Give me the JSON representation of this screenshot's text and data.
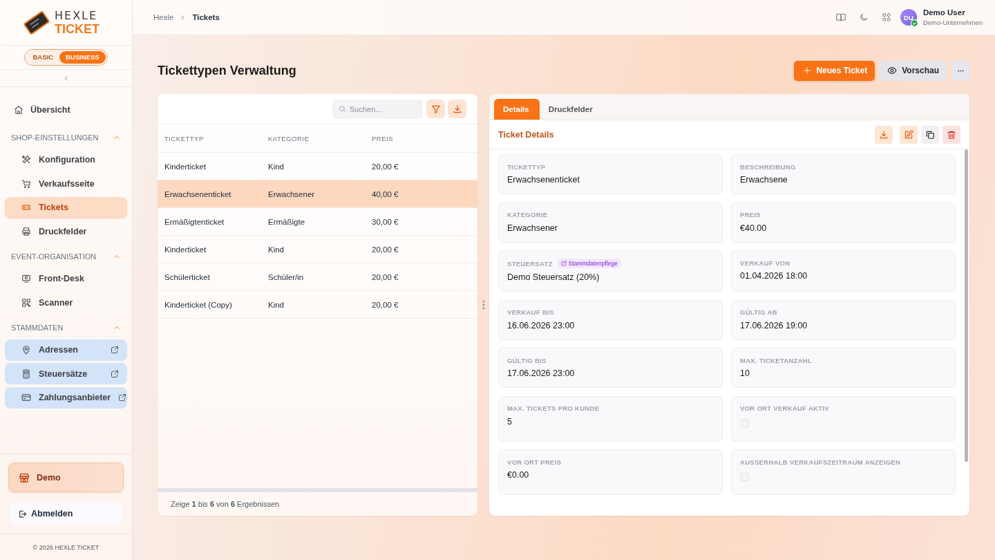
{
  "sidebar": {
    "logo": {
      "wordmark": "HEXLE",
      "product": "TICKET"
    },
    "plans": [
      {
        "label": "BASIC",
        "selected": false
      },
      {
        "label": "BUSINESS",
        "selected": true
      }
    ],
    "overview": {
      "label": "Übersicht",
      "selected": false
    },
    "sections": [
      {
        "title": "SHOP-EINSTELLUNGEN",
        "expanded": true,
        "items": [
          {
            "label": "Konfiguration",
            "selected": false,
            "external": false
          },
          {
            "label": "Verkaufsseite",
            "selected": false,
            "external": false
          },
          {
            "label": "Tickets",
            "selected": true,
            "external": false
          },
          {
            "label": "Druckfelder",
            "selected": false,
            "external": false
          }
        ]
      },
      {
        "title": "EVENT-ORGANISATION",
        "expanded": true,
        "items": [
          {
            "label": "Front-Desk",
            "selected": false,
            "external": false
          },
          {
            "label": "Scanner",
            "selected": false,
            "external": false
          }
        ]
      },
      {
        "title": "STAMMDATEN",
        "expanded": true,
        "items": [
          {
            "label": "Adressen",
            "selected": false,
            "external": true
          },
          {
            "label": "Steuersätze",
            "selected": false,
            "external": true
          },
          {
            "label": "Zahlungsanbieter",
            "selected": false,
            "external": true
          }
        ]
      }
    ],
    "shop_button": {
      "label": "Demo"
    },
    "logout": {
      "label": "Abmelden"
    },
    "copyright": "© 2026 HEXLE TICKET"
  },
  "topbar": {
    "breadcrumb": [
      "Hexle",
      "Tickets"
    ],
    "user": {
      "initials": "DU",
      "name": "Demo User",
      "company": "Demo-Unternehmen",
      "online": true
    }
  },
  "page": {
    "title": "Tickettypen Verwaltung",
    "actions": [
      {
        "kind": "primary",
        "label": "Neues Ticket"
      },
      {
        "kind": "secondary",
        "label": "Vorschau"
      },
      {
        "kind": "more"
      }
    ]
  },
  "table": {
    "search": {
      "placeholder": "Suchen..."
    },
    "columns": [
      "TICKETTYP",
      "KATEGORIE",
      "PREIS"
    ],
    "rows": [
      {
        "cells": [
          "Kinderticket",
          "Kind",
          "20,00 €"
        ],
        "selected": false
      },
      {
        "cells": [
          "Erwachsenenticket",
          "Erwachsener",
          "40,00 €"
        ],
        "selected": true
      },
      {
        "cells": [
          "Ermäßigtenticket",
          "Ermäßigte",
          "30,00 €"
        ],
        "selected": false
      },
      {
        "cells": [
          "Kinderticket",
          "Kind",
          "20,00 €"
        ],
        "selected": false
      },
      {
        "cells": [
          "Schülerticket",
          "Schüler/in",
          "20,00 €"
        ],
        "selected": false
      },
      {
        "cells": [
          "Kinderticket (Copy)",
          "Kind",
          "20,00 €"
        ],
        "selected": false
      }
    ],
    "footer": "Zeige **1** bis **6** von **6** Ergebnissen"
  },
  "detail": {
    "tabs": [
      {
        "label": "Details",
        "selected": true
      },
      {
        "label": "Druckfelder",
        "selected": false
      }
    ],
    "heading": "Ticket Details",
    "fields": [
      {
        "kind": "text",
        "label": "TICKETTYP",
        "value": "Erwachsenenticket"
      },
      {
        "kind": "text",
        "label": "BESCHREIBUNG",
        "value": "Erwachsene"
      },
      {
        "kind": "text",
        "label": "KATEGORIE",
        "value": "Erwachsener"
      },
      {
        "kind": "text",
        "label": "PREIS",
        "value": "€40.00"
      },
      {
        "kind": "text",
        "label": "STEUERSATZ",
        "badge": "Stammdatenpflege",
        "value": "Demo Steuersatz (20%)"
      },
      {
        "kind": "text",
        "label": "VERKAUF VON",
        "value": "01.04.2026 18:00"
      },
      {
        "kind": "text",
        "label": "VERKAUF BIS",
        "value": "16.06.2026 23:00"
      },
      {
        "kind": "text",
        "label": "GÜLTIG AB",
        "value": "17.06.2026 19:00"
      },
      {
        "kind": "text",
        "label": "GÜLTIG BIS",
        "value": "17.06.2026 23:00"
      },
      {
        "kind": "text",
        "label": "MAX. TICKETANZAHL",
        "value": "10"
      },
      {
        "kind": "text",
        "label": "MAX. TICKETS PRO KUNDE",
        "value": "5"
      },
      {
        "kind": "checkbox",
        "label": "VOR ORT VERKAUF AKTIV",
        "checked": false
      },
      {
        "kind": "text",
        "label": "VOR ORT PREIS",
        "value": "€0.00"
      },
      {
        "kind": "checkbox",
        "label": "AUSSERHALB VERKAUFSZEITRAUM ANZEIGEN",
        "checked": false
      }
    ]
  }
}
